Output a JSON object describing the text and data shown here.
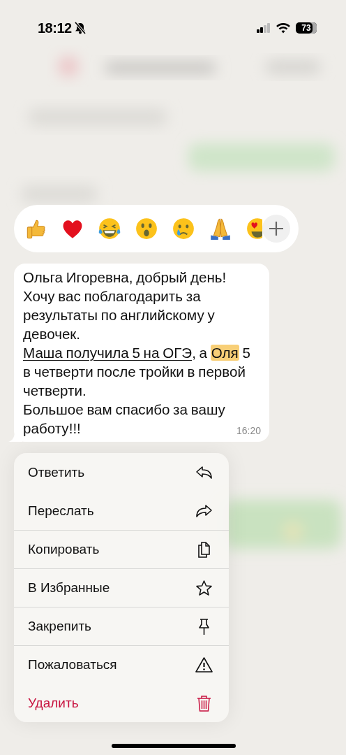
{
  "status_bar": {
    "time": "18:12",
    "silent": true,
    "battery": "73"
  },
  "message": {
    "segments": [
      {
        "kind": "plain",
        "text": "Ольга Игоревна, добрый день!\nХочу вас поблагодарить за результаты по английскому у девочек.\n"
      },
      {
        "kind": "link",
        "text": "Маша получила 5 на ОГЭ"
      },
      {
        "kind": "plain",
        "text": ", а "
      },
      {
        "kind": "highlight",
        "text": "Оля"
      },
      {
        "kind": "plain",
        "text": " 5 в четверти после тройки в первой четверти.\nБольшое вам спасибо за вашу работу!!!"
      }
    ],
    "time": "16:20"
  },
  "menu": [
    {
      "label": "Ответить",
      "kind": "normal",
      "separated": false
    },
    {
      "label": "Переслать",
      "kind": "normal",
      "separated": false
    },
    {
      "label": "Копировать",
      "kind": "normal",
      "separated": true
    },
    {
      "label": "В Избранные",
      "kind": "normal",
      "separated": true
    },
    {
      "label": "Закрепить",
      "kind": "normal",
      "separated": true
    },
    {
      "label": "Пожаловаться",
      "kind": "normal",
      "separated": true
    },
    {
      "label": "Удалить",
      "kind": "destructive",
      "separated": false
    }
  ]
}
